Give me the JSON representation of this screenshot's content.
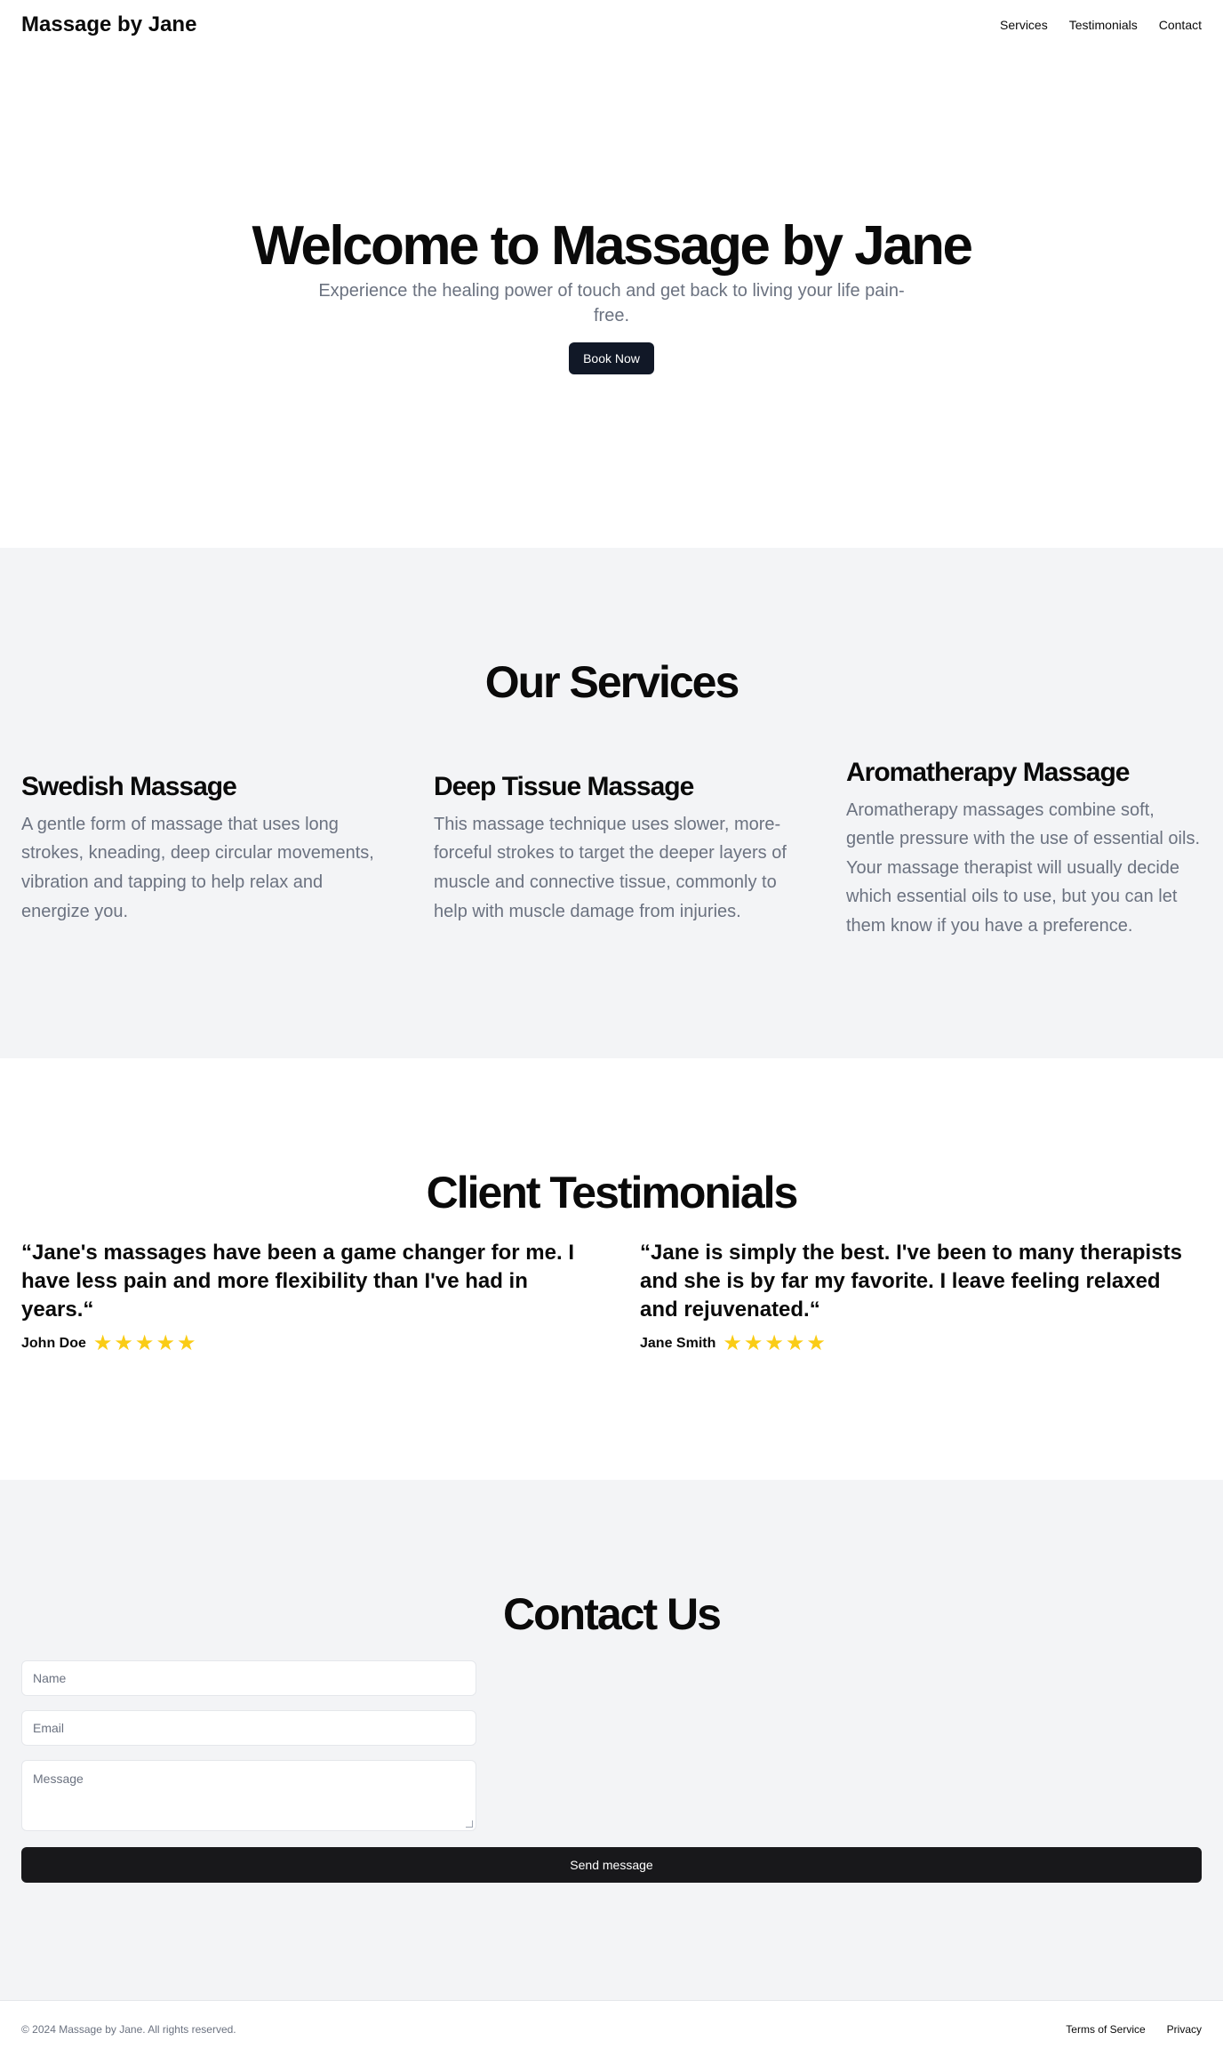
{
  "header": {
    "brand": "Massage by Jane",
    "nav": [
      "Services",
      "Testimonials",
      "Contact"
    ]
  },
  "hero": {
    "title": "Welcome to Massage by Jane",
    "subtitle": "Experience the healing power of touch and get back to living your life pain-free.",
    "cta": "Book Now"
  },
  "services": {
    "title": "Our Services",
    "items": [
      {
        "name": "Swedish Massage",
        "description": "A gentle form of massage that uses long strokes, kneading, deep circular movements, vibration and tapping to help relax and energize you."
      },
      {
        "name": "Deep Tissue Massage",
        "description": "This massage technique uses slower, more-forceful strokes to target the deeper layers of muscle and connective tissue, commonly to help with muscle damage from injuries."
      },
      {
        "name": "Aromatherapy Massage",
        "description": "Aromatherapy massages combine soft, gentle pressure with the use of essential oils. Your massage therapist will usually decide which essential oils to use, but you can let them know if you have a preference."
      }
    ]
  },
  "testimonials": {
    "title": "Client Testimonials",
    "items": [
      {
        "quote": "“Jane's massages have been a game changer for me. I have less pain and more flexibility than I've had in years.“",
        "author": "John Doe",
        "rating": 5
      },
      {
        "quote": "“Jane is simply the best. I've been to many therapists and she is by far my favorite. I leave feeling relaxed and rejuvenated.“",
        "author": "Jane Smith",
        "rating": 5
      }
    ],
    "star_glyph": "⭐"
  },
  "contact": {
    "title": "Contact Us",
    "name_placeholder": "Name",
    "email_placeholder": "Email",
    "message_placeholder": "Message",
    "submit": "Send message"
  },
  "footer": {
    "copyright": "© 2024 Massage by Jane. All rights reserved.",
    "links": [
      "Terms of Service",
      "Privacy"
    ]
  },
  "colors": {
    "primary_button": "#111827",
    "send_button": "#18181b",
    "section_bg": "#f3f4f6",
    "muted_text": "#6b7280",
    "star": "#facc15"
  }
}
